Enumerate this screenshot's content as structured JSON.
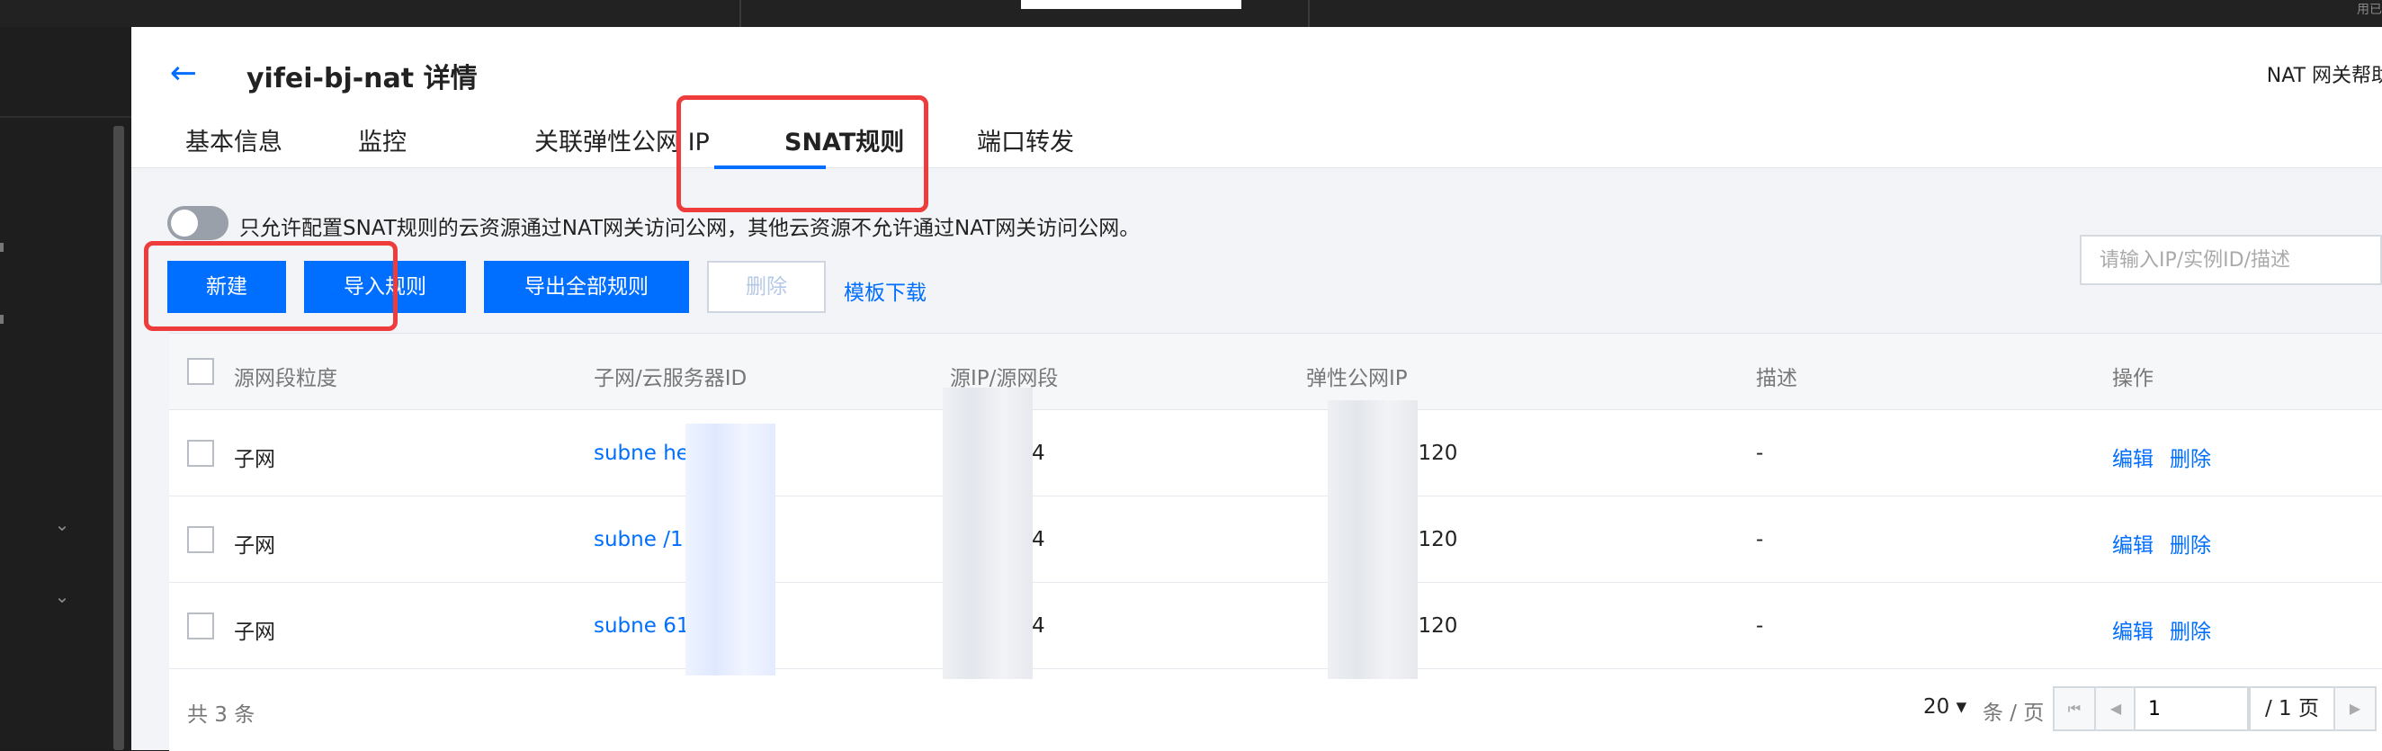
{
  "topbar": {
    "corner_text": "用已"
  },
  "header": {
    "title": "yifei-bj-nat 详情",
    "help_link": "NAT 网关帮助"
  },
  "tabs": [
    "基本信息",
    "监控",
    "关联弹性公网 IP",
    "SNAT规则",
    "端口转发"
  ],
  "active_tab": "SNAT规则",
  "toggle": {
    "label": "只允许配置SNAT规则的云资源通过NAT网关访问公网，其他云资源不允许通过NAT网关访问公网。",
    "on": false
  },
  "toolbar": {
    "new": "新建",
    "import": "导入规则",
    "export_all": "导出全部规则",
    "delete": "删除",
    "template_download": "模板下载"
  },
  "search": {
    "placeholder": "请输入IP/实例ID/描述"
  },
  "table": {
    "columns": [
      "源网段粒度",
      "子网/云服务器ID",
      "源IP/源网段",
      "弹性公网IP",
      "描述",
      "操作"
    ],
    "rows": [
      {
        "granularity": "子网",
        "resource_id": "subne      hemz",
        "source_ip": "2.0/24",
        "eip": ".108.120",
        "description": "-",
        "edit": "编辑",
        "delete": "删除"
      },
      {
        "granularity": "子网",
        "resource_id": "subne      /1",
        "source_ip": "0.0/24",
        "eip": ".108.120",
        "description": "-",
        "edit": "编辑",
        "delete": "删除"
      },
      {
        "granularity": "子网",
        "resource_id": "subne      61",
        "source_ip": "3.0/24",
        "eip": ".108.120",
        "description": "-",
        "edit": "编辑",
        "delete": "删除"
      }
    ]
  },
  "pagination": {
    "total_label": "共 3 条",
    "page_size": "20 ▾",
    "per_page_label": "条 / 页",
    "current_page": "1",
    "total_pages": "/ 1 页"
  },
  "colors": {
    "accent": "#006eff",
    "highlight": "#ee3b3b"
  }
}
